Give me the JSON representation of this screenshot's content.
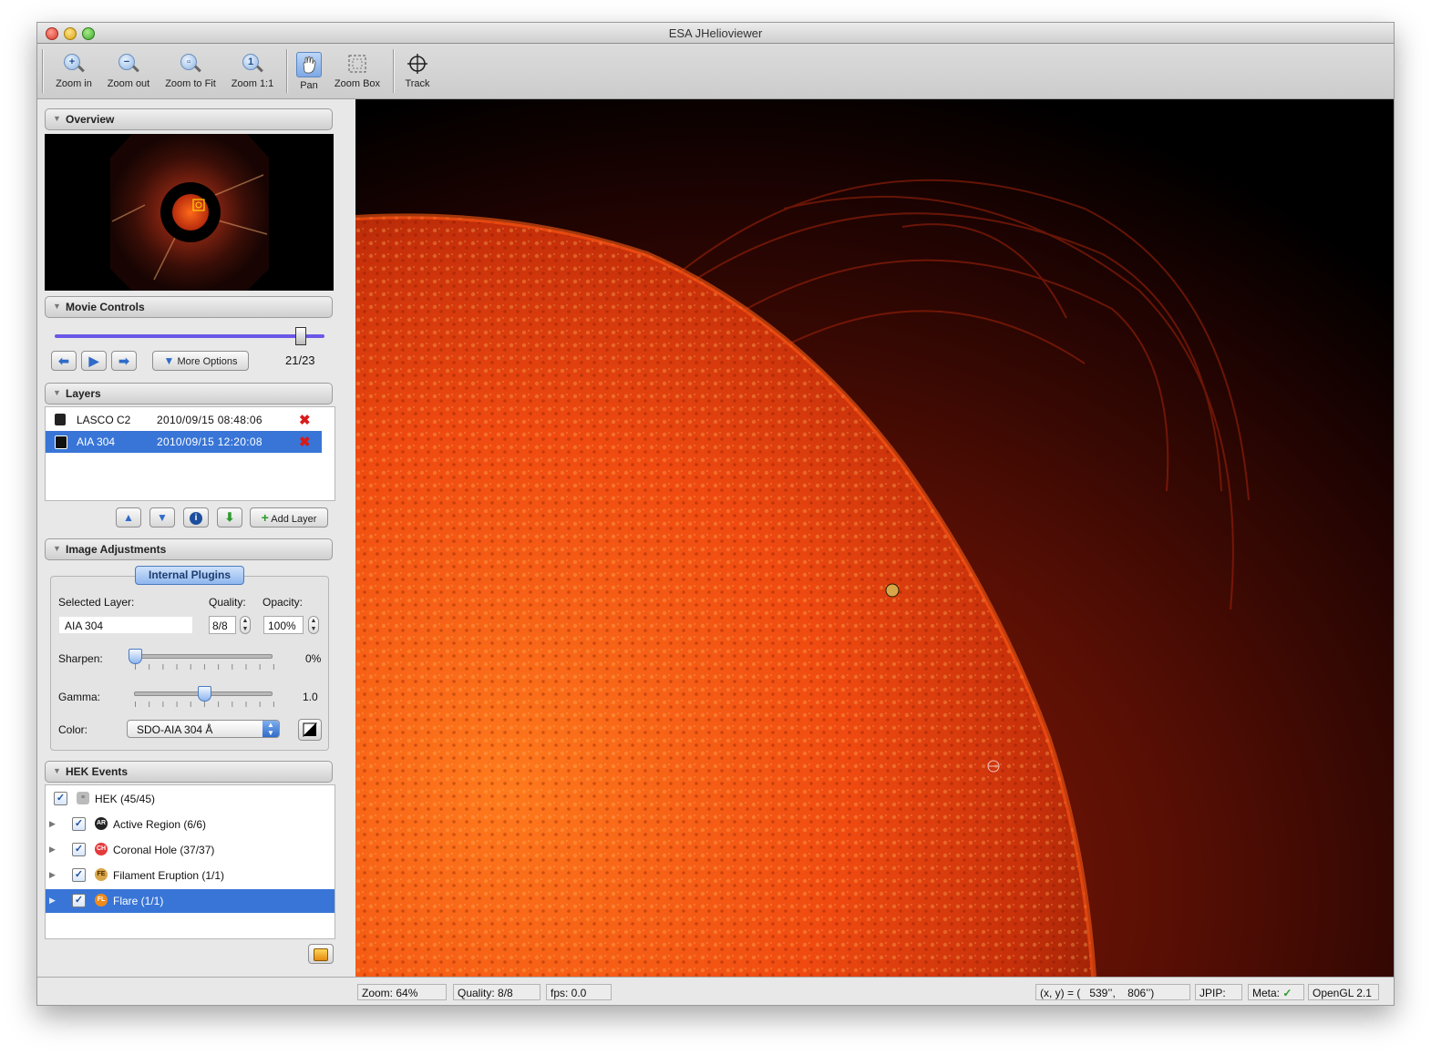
{
  "window": {
    "title": "ESA JHelioviewer"
  },
  "toolbar": {
    "zoom_in": "Zoom in",
    "zoom_out": "Zoom out",
    "zoom_fit": "Zoom to Fit",
    "zoom_11": "Zoom 1:1",
    "pan": "Pan",
    "zoom_box": "Zoom Box",
    "track": "Track"
  },
  "sections": {
    "overview": "Overview",
    "movie": "Movie Controls",
    "layers": "Layers",
    "adjust": "Image Adjustments",
    "hek": "HEK Events"
  },
  "movie": {
    "more_options": "More Options",
    "frame": "21/23",
    "position_fraction": 0.91
  },
  "layers": {
    "rows": [
      {
        "name": "LASCO C2",
        "date": "2010/09/15 08:48:06"
      },
      {
        "name": "AIA 304",
        "date": "2010/09/15 12:20:08"
      }
    ],
    "add_layer": "Add Layer"
  },
  "adjust": {
    "tab": "Internal Plugins",
    "selected_layer_label": "Selected Layer:",
    "quality_label": "Quality:",
    "opacity_label": "Opacity:",
    "selected_layer_value": "AIA 304",
    "quality_value": "8/8",
    "opacity_value": "100%",
    "sharpen_label": "Sharpen:",
    "sharpen_value": "0%",
    "gamma_label": "Gamma:",
    "gamma_value": "1.0",
    "color_label": "Color:",
    "color_value": "SDO-AIA 304 Å"
  },
  "hek": {
    "root": "HEK (45/45)",
    "items": [
      {
        "label": "Active Region (6/6)",
        "icon": "AR"
      },
      {
        "label": "Coronal Hole (37/37)",
        "icon": "CH"
      },
      {
        "label": "Filament Eruption (1/1)",
        "icon": "FE"
      },
      {
        "label": "Flare (1/1)",
        "icon": "FL"
      }
    ]
  },
  "status": {
    "zoom": "Zoom: 64%",
    "quality": "Quality: 8/8",
    "fps": "fps: 0.0",
    "coords": "(x, y) = (   539’’,    806’’)",
    "jpip": "JPIP:",
    "meta": "Meta:",
    "opengl": "OpenGL 2.1"
  },
  "colors": {
    "accent": "#3875d7",
    "slider": "#6a57e8",
    "remove": "#d81b1b"
  }
}
